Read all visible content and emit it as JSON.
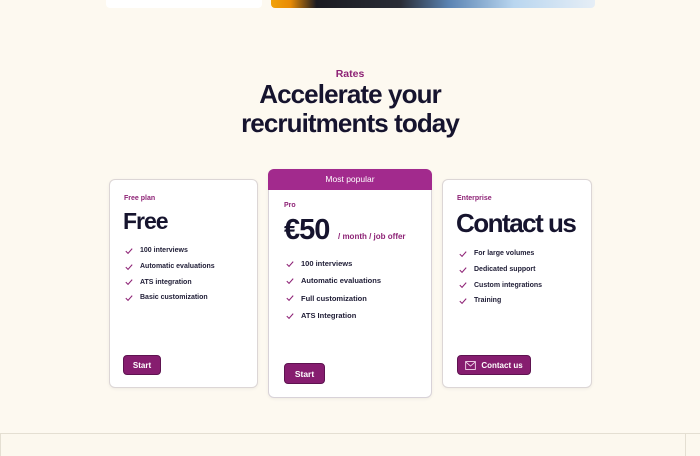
{
  "rates": {
    "eyebrow": "Rates",
    "title_line1": "Accelerate your",
    "title_line2": "recruitments today"
  },
  "plans": [
    {
      "label": "Free plan",
      "price": "Free",
      "price_suffix": "",
      "features": [
        "100 interviews",
        "Automatic evaluations",
        "ATS integration",
        "Basic customization"
      ],
      "button": "Start"
    },
    {
      "badge": "Most popular",
      "label": "Pro",
      "price": "€50",
      "price_suffix": "/ month / job offer",
      "features": [
        "100 interviews",
        "Automatic evaluations",
        "Full customization",
        "ATS Integration"
      ],
      "button": "Start"
    },
    {
      "label": "Enterprise",
      "price": "Contact us",
      "price_suffix": "",
      "features": [
        "For large volumes",
        "Dedicated support",
        "Custom integrations",
        "Training"
      ],
      "button": "Contact us",
      "button_icon": "mail-icon"
    }
  ],
  "colors": {
    "background": "#fdf9f0",
    "accent": "#8e2376",
    "button": "#861d6f",
    "banner": "#a22a8d",
    "heading": "#16142e"
  },
  "icons": {
    "feature_check": "check-icon"
  }
}
